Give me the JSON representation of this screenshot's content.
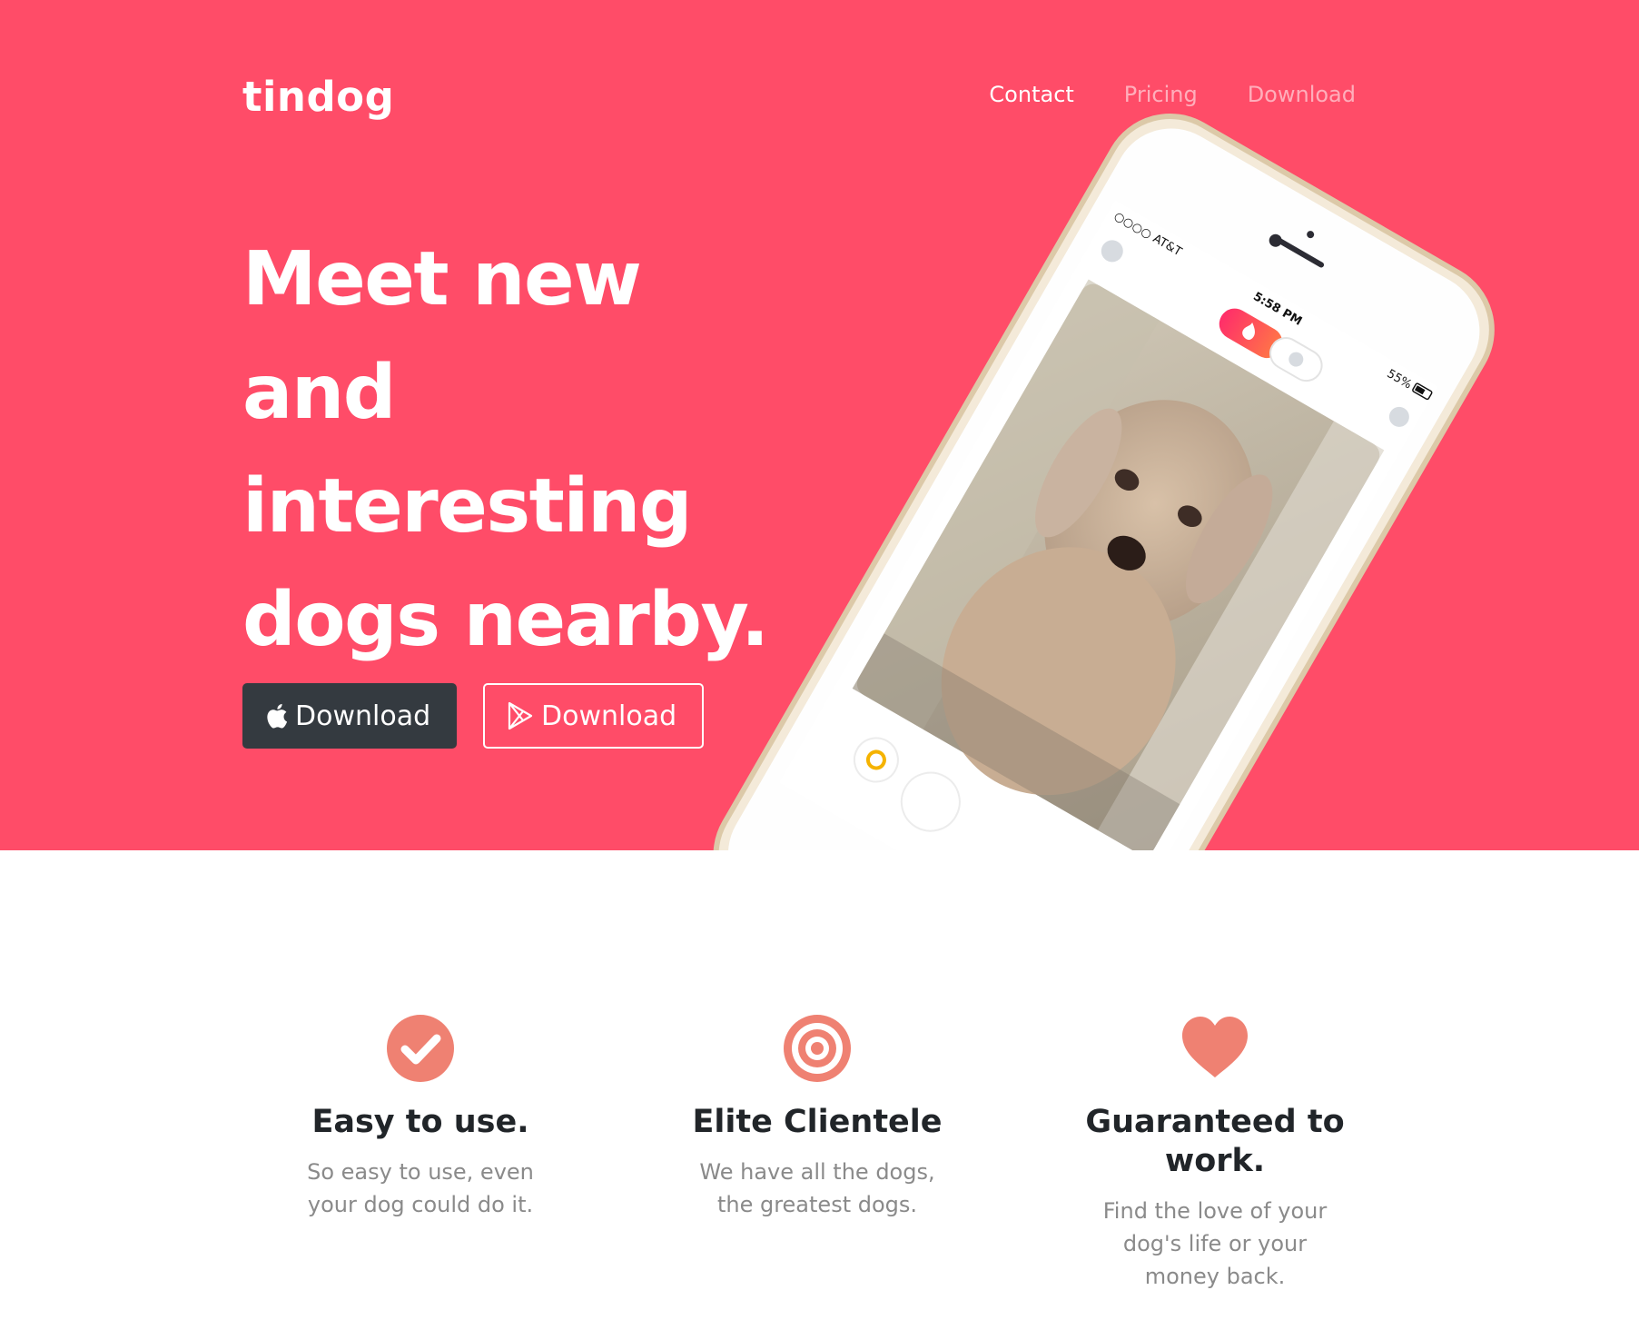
{
  "brand": {
    "name": "tindog"
  },
  "nav": {
    "items": [
      "Contact",
      "Pricing",
      "Download"
    ],
    "active_index": 0
  },
  "hero": {
    "headline_lines": [
      "Meet new",
      "and",
      "interesting",
      "dogs nearby."
    ],
    "buttons": {
      "apple_label": "Download",
      "google_label": "Download"
    },
    "background_color": "#ff4c68",
    "phone": {
      "carrier": "○○○○ AT&T",
      "time": "5:58 PM",
      "battery": "55%",
      "icons": [
        "profile-icon",
        "flame-icon",
        "friends-icon",
        "chat-icon",
        "rewind-icon",
        "dislike-icon"
      ]
    }
  },
  "features": [
    {
      "icon": "check-circle-icon",
      "title": "Easy to use.",
      "text": "So easy to use, even your dog could do it."
    },
    {
      "icon": "bullseye-icon",
      "title": "Elite Clientele",
      "text": "We have all the dogs, the greatest dogs."
    },
    {
      "icon": "heart-icon",
      "title": "Guaranteed to work.",
      "text": "Find the love of your dog's life or your money back."
    }
  ],
  "colors": {
    "accent": "#ff4c68",
    "icon": "#ef8172",
    "dark_button": "#343a40",
    "text_dark": "#212529",
    "text_muted": "#8a8a8a"
  }
}
